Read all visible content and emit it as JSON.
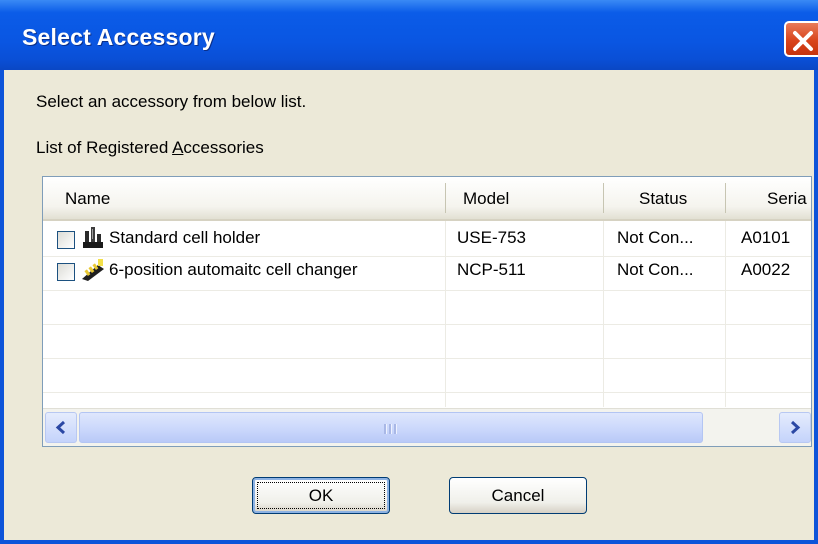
{
  "window": {
    "title": "Select Accessory"
  },
  "instructions": "Select an accessory from below list.",
  "list_label_prefix": "List of Registered ",
  "list_label_underlined": "A",
  "list_label_suffix": "ccessories",
  "columns": [
    "Name",
    "Model",
    "Status",
    "Seria"
  ],
  "rows": [
    {
      "name": "Standard cell holder",
      "model": "USE-753",
      "status": "Not Con...",
      "serial": "A0101",
      "checked": false,
      "icon": "cell-holder-icon"
    },
    {
      "name": "6-position automaitc cell changer",
      "model": "NCP-511",
      "status": "Not Con...",
      "serial": "A0022",
      "checked": false,
      "icon": "cell-changer-icon"
    }
  ],
  "buttons": {
    "ok": "OK",
    "cancel": "Cancel"
  },
  "colors": {
    "titlebar": "#0a56e2",
    "close": "#d9441b",
    "dialog_bg": "#ece9d8"
  }
}
